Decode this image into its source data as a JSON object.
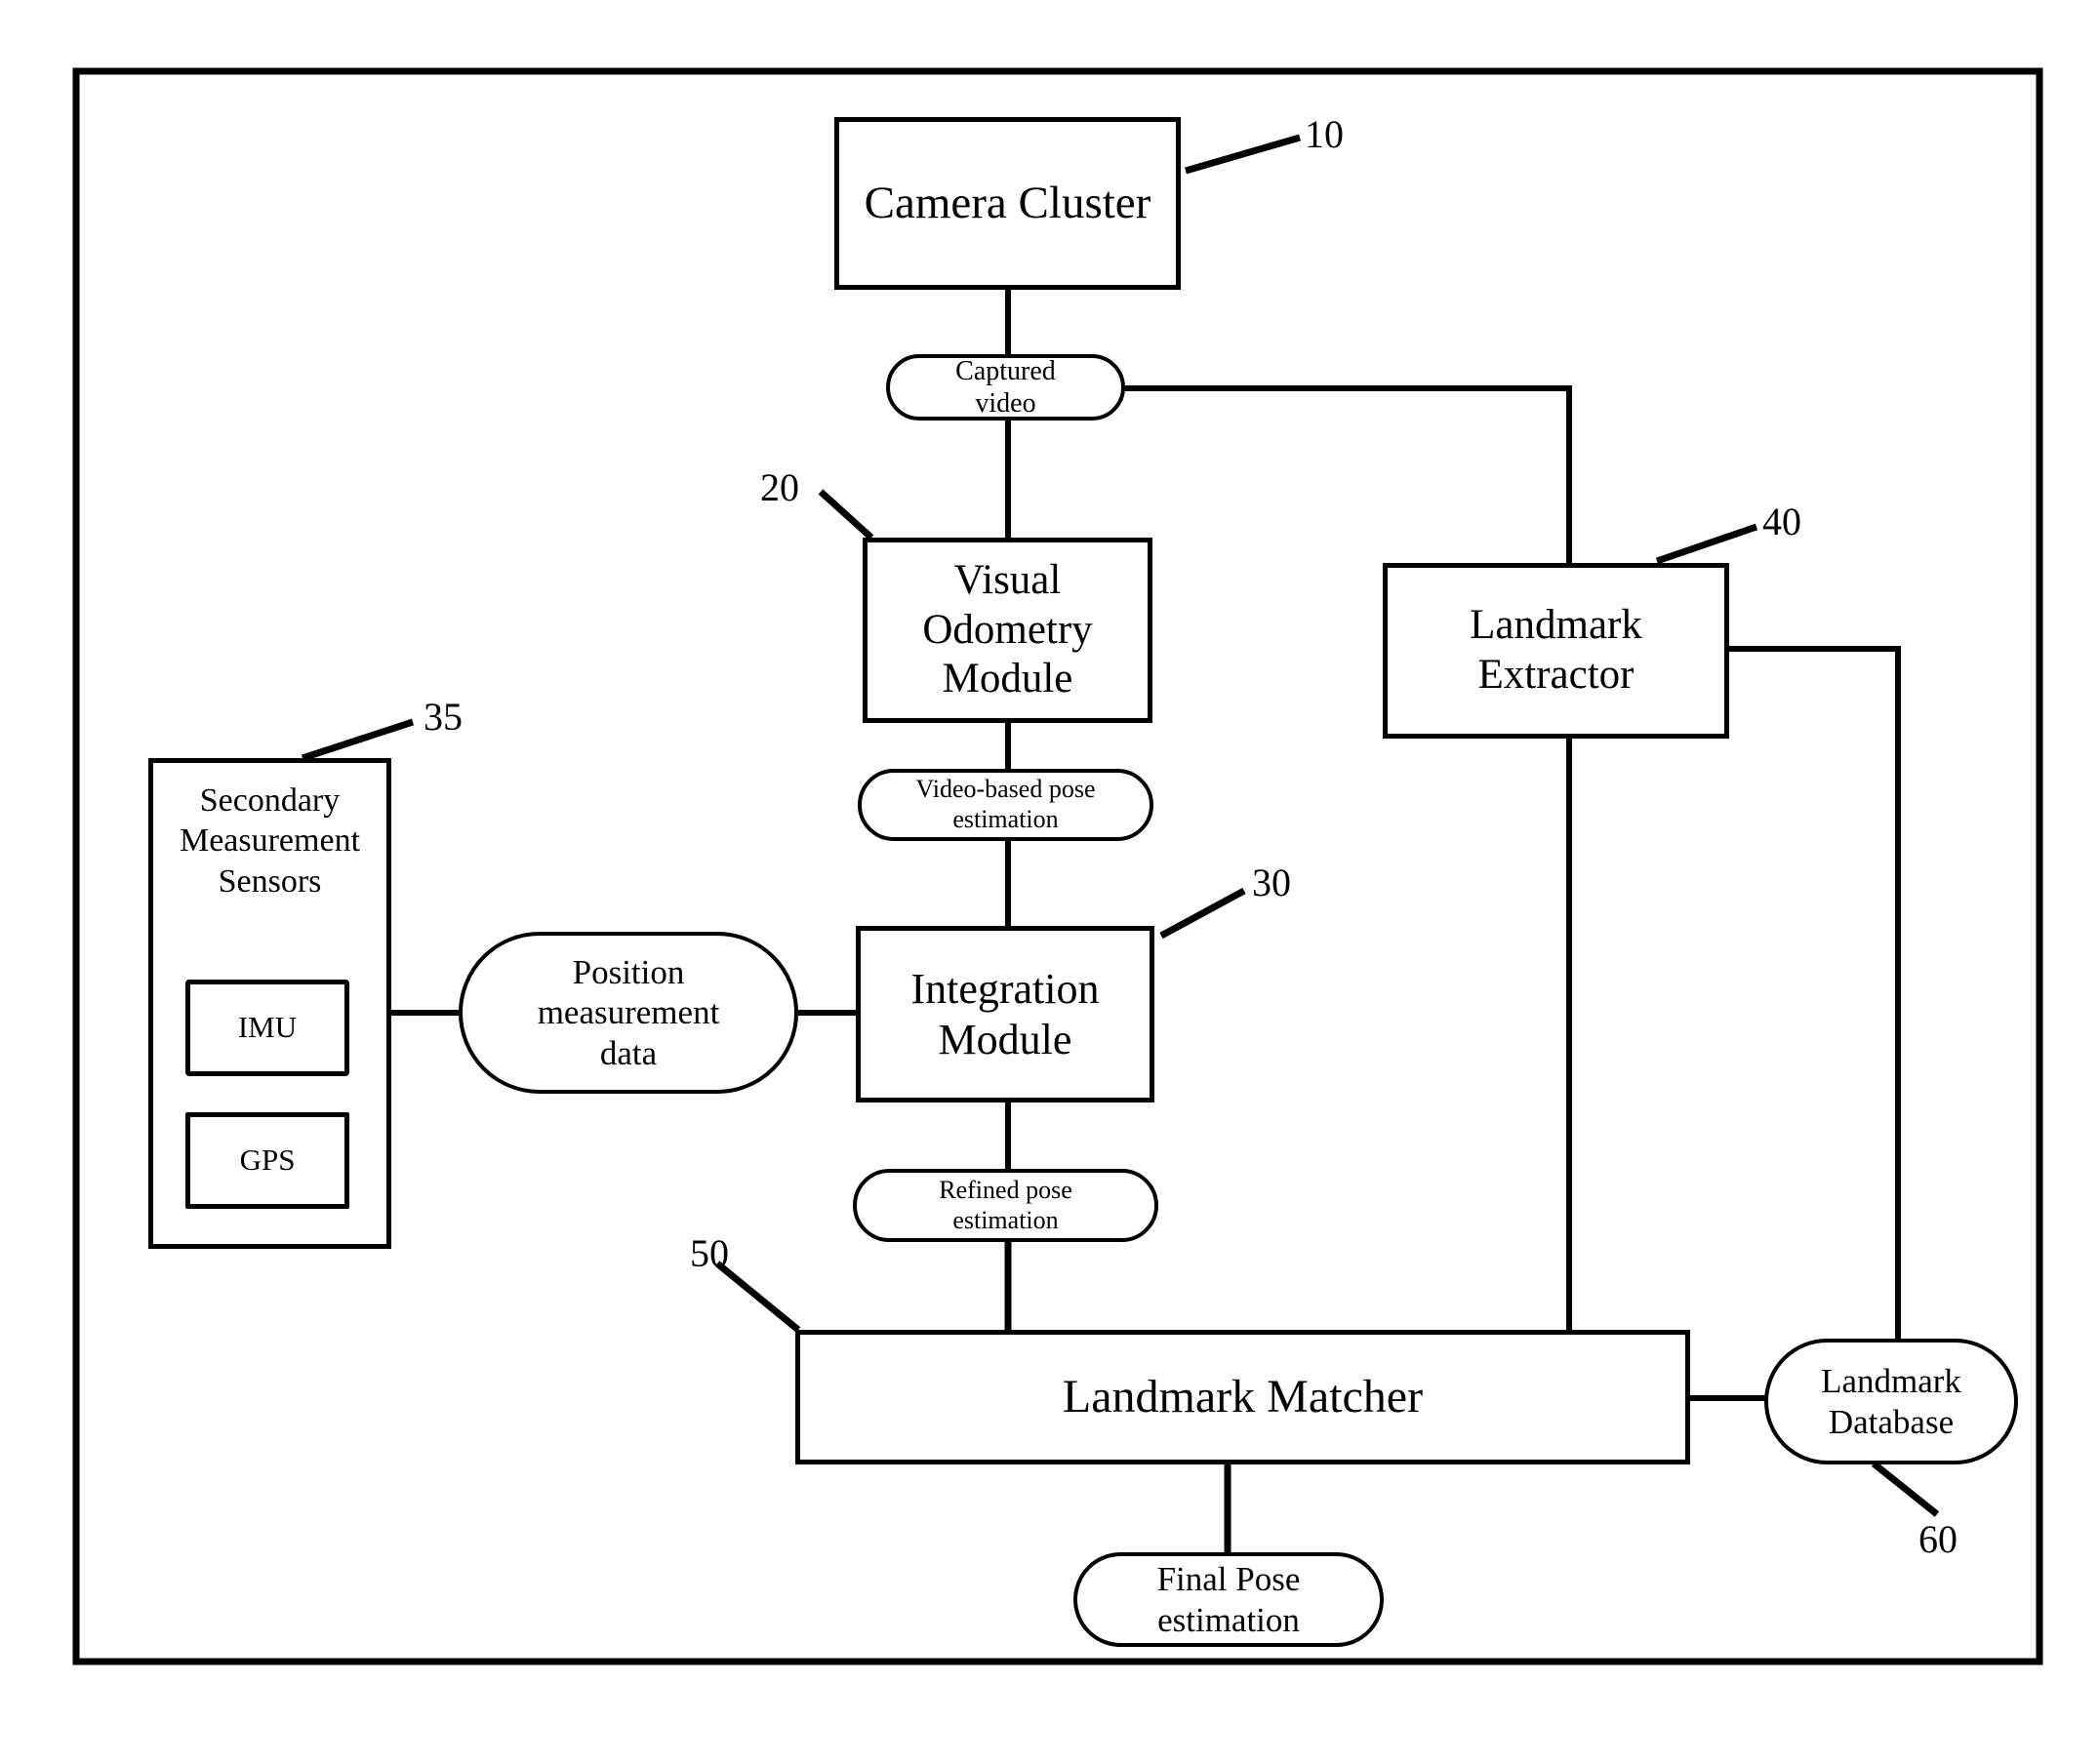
{
  "figure": {
    "type": "patent-block-diagram",
    "frame": {
      "present": true,
      "style": "solid-rectangle-border"
    }
  },
  "nodes": {
    "camera_cluster": {
      "label": "Camera Cluster",
      "shape": "rectangle",
      "ref": "10"
    },
    "captured_video": {
      "label": "Captured\nvideo",
      "shape": "pill",
      "ref": ""
    },
    "visual_odometry": {
      "label": "Visual\nOdometry\nModule",
      "shape": "rectangle",
      "ref": "20"
    },
    "landmark_extractor": {
      "label": "Landmark\nExtractor",
      "shape": "rectangle",
      "ref": "40"
    },
    "video_based_pose": {
      "label": "Video-based pose\nestimation",
      "shape": "pill",
      "ref": ""
    },
    "secondary_sensors": {
      "label": "Secondary\nMeasurement\nSensors",
      "shape": "rectangle",
      "ref": "35"
    },
    "imu": {
      "label": "IMU",
      "shape": "rectangle",
      "ref": ""
    },
    "gps": {
      "label": "GPS",
      "shape": "rectangle",
      "ref": ""
    },
    "position_measurement": {
      "label": "Position\nmeasurement\ndata",
      "shape": "pill",
      "ref": ""
    },
    "integration_module": {
      "label": "Integration\nModule",
      "shape": "rectangle",
      "ref": "30"
    },
    "refined_pose": {
      "label": "Refined pose\nestimation",
      "shape": "pill",
      "ref": ""
    },
    "landmark_matcher": {
      "label": "Landmark Matcher",
      "shape": "rectangle",
      "ref": "50"
    },
    "landmark_database": {
      "label": "Landmark\nDatabase",
      "shape": "pill",
      "ref": "60"
    },
    "final_pose": {
      "label": "Final Pose\nestimation",
      "shape": "pill",
      "ref": ""
    }
  },
  "reference_numerals": {
    "n10": "10",
    "n20": "20",
    "n30": "30",
    "n35": "35",
    "n40": "40",
    "n50": "50",
    "n60": "60"
  },
  "connections": [
    {
      "from": "camera_cluster",
      "to": "captured_video",
      "style": "straight-vertical"
    },
    {
      "from": "captured_video",
      "to": "visual_odometry",
      "style": "straight-vertical"
    },
    {
      "from": "captured_video",
      "to": "landmark_extractor",
      "style": "orthogonal-right-down"
    },
    {
      "from": "visual_odometry",
      "to": "video_based_pose",
      "style": "straight-vertical"
    },
    {
      "from": "video_based_pose",
      "to": "integration_module",
      "style": "straight-vertical"
    },
    {
      "from": "secondary_sensors",
      "to": "position_measurement",
      "style": "straight-horizontal"
    },
    {
      "from": "position_measurement",
      "to": "integration_module",
      "style": "straight-horizontal"
    },
    {
      "from": "integration_module",
      "to": "refined_pose",
      "style": "straight-vertical"
    },
    {
      "from": "refined_pose",
      "to": "landmark_matcher",
      "style": "straight-vertical"
    },
    {
      "from": "landmark_extractor",
      "to": "landmark_matcher",
      "style": "straight-vertical"
    },
    {
      "from": "landmark_extractor",
      "to": "landmark_database",
      "style": "orthogonal-right-down"
    },
    {
      "from": "landmark_matcher",
      "to": "landmark_database",
      "style": "straight-horizontal"
    },
    {
      "from": "landmark_matcher",
      "to": "final_pose",
      "style": "straight-vertical"
    }
  ],
  "colors": {
    "stroke": "#000000",
    "background": "#ffffff",
    "text": "#000000"
  }
}
